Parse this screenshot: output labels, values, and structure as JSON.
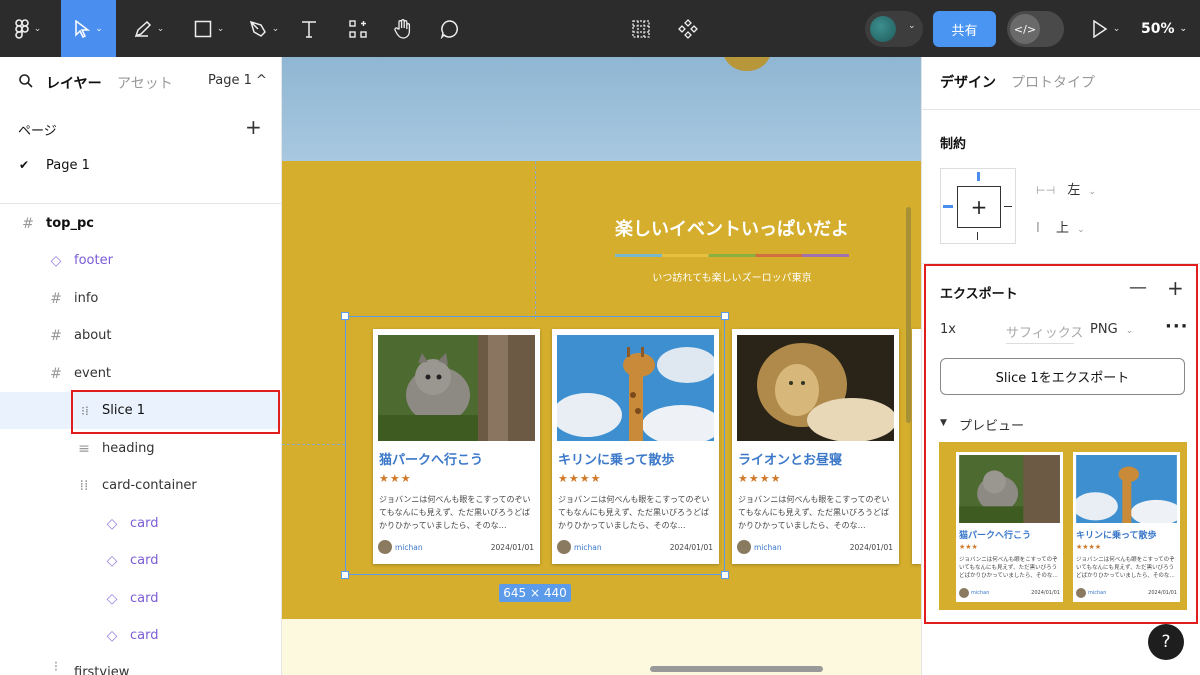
{
  "toolbar": {
    "share_label": "共有",
    "zoom": "50%"
  },
  "left_panel": {
    "tab_layers": "レイヤー",
    "tab_assets": "アセット",
    "page_selector": "Page 1 ^",
    "pages_header": "ページ",
    "current_page": "Page 1",
    "layers": [
      {
        "name": "top_pc"
      },
      {
        "name": "footer"
      },
      {
        "name": "info"
      },
      {
        "name": "about"
      },
      {
        "name": "event"
      },
      {
        "name": "Slice 1"
      },
      {
        "name": "heading"
      },
      {
        "name": "card-container"
      },
      {
        "name": "card"
      },
      {
        "name": "card"
      },
      {
        "name": "card"
      },
      {
        "name": "card"
      },
      {
        "name": "firstview"
      }
    ]
  },
  "canvas": {
    "event_title": "楽しいイベントいっぱいだよ",
    "event_subtitle": "いつ訪れても楽しいズーロッパ東京",
    "selection_size": "645 × 440",
    "cards": [
      {
        "title": "猫パークへ行こう",
        "stars": "★★★",
        "desc": "ジョバンニは何べんも眼をこすってのぞいてもなんにも見えず、ただ黒いびろうどばかりひかっていましたら、そのな…",
        "author": "michan",
        "date": "2024/01/01"
      },
      {
        "title": "キリンに乗って散歩",
        "stars": "★★★★",
        "desc": "ジョバンニは何べんも眼をこすってのぞいてもなんにも見えず、ただ黒いびろうどばかりひかっていましたら、そのな…",
        "author": "michan",
        "date": "2024/01/01"
      },
      {
        "title": "ライオンとお昼寝",
        "stars": "★★★★",
        "desc": "ジョバンニは何べんも眼をこすってのぞいてもなんにも見えず、ただ黒いびろうどばかりひかっていましたら、そのな…",
        "author": "michan",
        "date": "2024/01/01"
      }
    ]
  },
  "right_panel": {
    "tab_design": "デザイン",
    "tab_prototype": "プロトタイプ",
    "constraints_header": "制約",
    "constraint_h": "左",
    "constraint_v": "上",
    "export_header": "エクスポート",
    "export_scale": "1x",
    "export_suffix_placeholder": "サフィックス",
    "export_format": "PNG",
    "export_button": "Slice 1をエクスポート",
    "preview_header": "プレビュー",
    "help": "?"
  },
  "colors": {
    "accent": "#4a94f2",
    "canvas_bg": "#d4ae2c",
    "highlight": "#e01e1e",
    "card_title": "#3b78c9"
  }
}
